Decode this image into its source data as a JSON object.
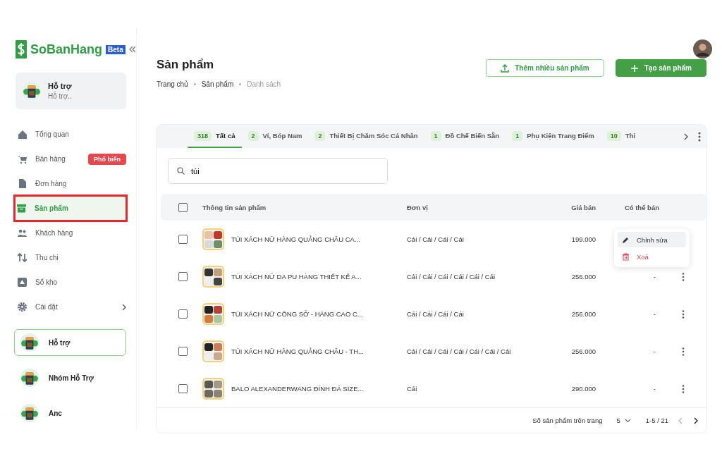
{
  "sidebar": {
    "logo": {
      "text": "SoBanHang",
      "badge": "Beta"
    },
    "store": {
      "name": "Hỗ trợ",
      "subtitle": "Hỗ trợ.."
    },
    "nav": [
      {
        "label": "Tổng quan",
        "selected": false
      },
      {
        "label": "Bán hàng",
        "selected": false,
        "badge": "Phổ biến"
      },
      {
        "label": "Đơn hàng",
        "selected": false
      },
      {
        "label": "Sản phẩm",
        "selected": true,
        "outlined": true
      },
      {
        "label": "Khách hàng",
        "selected": false
      },
      {
        "label": "Thu chi",
        "selected": false
      },
      {
        "label": "Sổ kho",
        "selected": false
      },
      {
        "label": "Cài đặt",
        "selected": false,
        "expandable": true
      }
    ],
    "stores": [
      {
        "name": "Hỗ trợ",
        "selected": true
      },
      {
        "name": "Nhóm Hỗ Trợ",
        "selected": false
      },
      {
        "name": "Anc",
        "selected": false
      }
    ]
  },
  "header": {
    "title": "Sản phẩm",
    "breadcrumbs": [
      "Trang chủ",
      "Sản phẩm",
      "Danh sách"
    ],
    "buttons": [
      {
        "label": "Thêm nhiều sản phẩm",
        "kind": "upload"
      },
      {
        "label": "Tạo sản phẩm",
        "kind": "create"
      }
    ]
  },
  "tabs": [
    {
      "count": "318",
      "label": "Tất cả",
      "selected": true
    },
    {
      "count": "2",
      "label": "Ví, Bóp Nam",
      "selected": false
    },
    {
      "count": "2",
      "label": "Thiết Bị Chăm Sóc Cá Nhân",
      "selected": false
    },
    {
      "count": "1",
      "label": "Đồ Chế Biến Sẵn",
      "selected": false
    },
    {
      "count": "1",
      "label": "Phụ Kiện Trang Điểm",
      "selected": false
    },
    {
      "count": "10",
      "label": "Thi",
      "selected": false
    }
  ],
  "search": {
    "value": "túi"
  },
  "table": {
    "all_selected": false,
    "columns": [
      "Thông tin sản phẩm",
      "Đơn vị",
      "Giá bán",
      "Có thể bán"
    ],
    "rows": [
      {
        "name": "TÚI XÁCH NỮ HÀNG QUẢNG CHÂU CA...",
        "unit": "Cái / Cái / Cái / Cái",
        "price": "199.000",
        "selected": false
      },
      {
        "name": "TÚI XÁCH NỮ DA PU HÀNG THIẾT KẾ A...",
        "unit": "Cái / Cái / Cái / Cái / Cái / Cái",
        "price": "256.000",
        "available": "-",
        "selected": false
      },
      {
        "name": "TÚI XÁCH NỮ CÔNG SỞ - HÀNG CAO C...",
        "unit": "Cái / Cái / Cái / Cái",
        "price": "256.000",
        "available": "-",
        "selected": false
      },
      {
        "name": "TÚI XÁCH NỮ HÀNG QUẢNG CHÂU - TH...",
        "unit": "Cái / Cái / Cái / Cái / Cái / Cái / Cái",
        "price": "256.000",
        "available": "-",
        "selected": false
      },
      {
        "name": "BALO ALEXANDERWANG ĐÍNH ĐÁ SIZE...",
        "unit": "Cái",
        "price": "290.000",
        "available": "-",
        "selected": false
      }
    ]
  },
  "row_menu": {
    "items": [
      {
        "label": "Chỉnh sửa",
        "kind": "edit",
        "selected": true
      },
      {
        "label": "Xoá",
        "kind": "delete",
        "selected": false
      }
    ]
  },
  "pagination": {
    "per_page_label": "Số sản phẩm trên trang",
    "per_page": "5",
    "range": "1-5 / 21"
  }
}
